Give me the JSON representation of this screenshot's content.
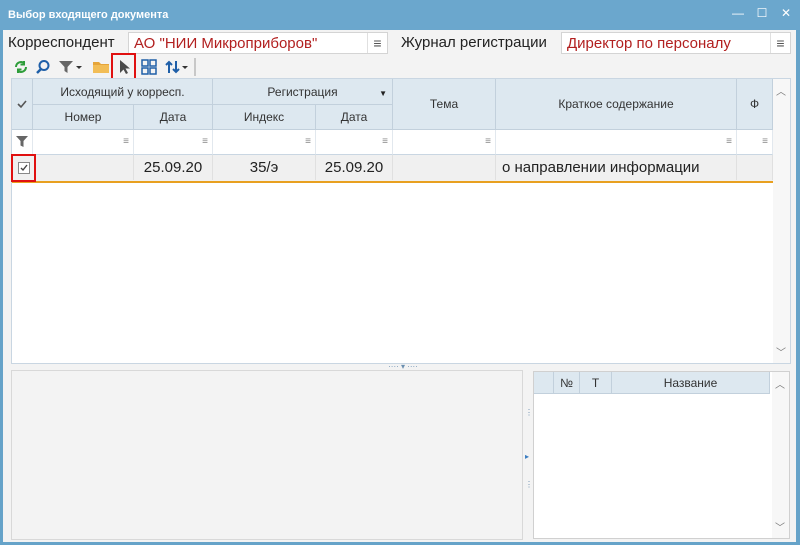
{
  "window": {
    "title": "Выбор входящего документа",
    "minimize_glyph": "—",
    "maximize_glyph": "☐",
    "close_glyph": "✕"
  },
  "fields": {
    "correspondent_label": "Корреспондент",
    "correspondent_value": "АО \"НИИ Микроприборов\"",
    "journal_label": "Журнал регистрации",
    "journal_value": "Директор по персоналу",
    "menu_glyph": "≡"
  },
  "toolbar": {
    "icons": [
      "refresh-icon",
      "search-icon",
      "filter-icon",
      "folder-icon",
      "select-pointer-icon",
      "layout-icon",
      "sort-icon"
    ]
  },
  "grid": {
    "group_headers": {
      "outgoing": "Исходящий у корресп.",
      "registration": "Регистрация"
    },
    "columns": {
      "number": "Номер",
      "out_date": "Дата",
      "index": "Индекс",
      "reg_date": "Дата",
      "topic": "Тема",
      "summary": "Краткое содержание",
      "f": "Ф"
    },
    "rows": [
      {
        "number": "",
        "out_date": "25.09.20",
        "index": "35/э",
        "reg_date": "25.09.20",
        "topic": "",
        "summary": "о направлении информации",
        "checked": true
      }
    ]
  },
  "attachments": {
    "columns": {
      "no": "№",
      "t": "Т",
      "name": "Название"
    }
  },
  "colors": {
    "title_bar": "#6ba7cd",
    "header_bg": "#dde8f0",
    "value_text": "#b22020",
    "highlight": "#e01010",
    "row_underline": "#e8a020"
  }
}
